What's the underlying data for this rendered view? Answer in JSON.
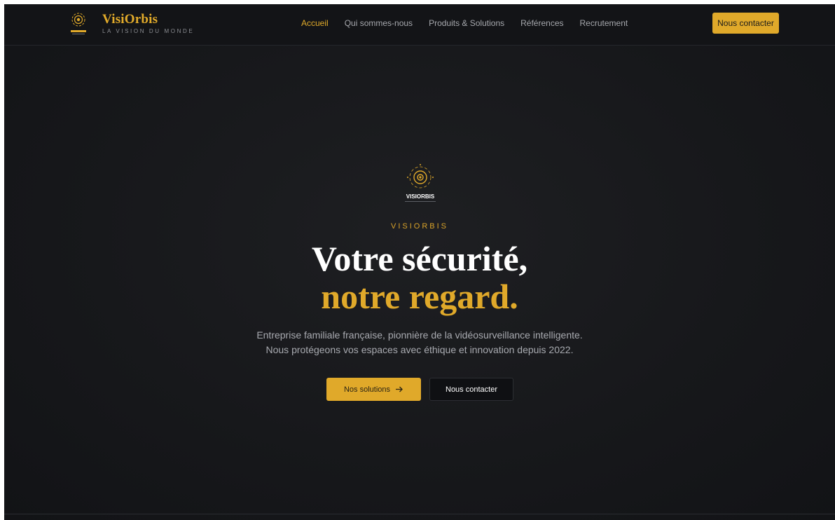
{
  "brand": {
    "name": "VisiOrbis",
    "tagline": "LA VISION DU MONDE",
    "logo_icon": "eye-target-icon",
    "accent_color": "#e0a92a"
  },
  "nav": {
    "items": [
      {
        "label": "Accueil",
        "active": true
      },
      {
        "label": "Qui sommes-nous",
        "active": false
      },
      {
        "label": "Produits & Solutions",
        "active": false
      },
      {
        "label": "Références",
        "active": false
      },
      {
        "label": "Recrutement",
        "active": false
      }
    ],
    "cta_label": "Nous contacter"
  },
  "hero": {
    "logo_text": "VISIORBIS",
    "eyebrow": "VISIORBIS",
    "title_line1": "Votre sécurité,",
    "title_line2": "notre regard.",
    "description": "Entreprise familiale française, pionnière de la vidéosurveillance intelligente. Nous protégeons vos espaces avec éthique et innovation depuis 2022.",
    "primary_button": "Nos solutions",
    "primary_button_icon": "arrow-right-icon",
    "secondary_button": "Nous contacter"
  }
}
